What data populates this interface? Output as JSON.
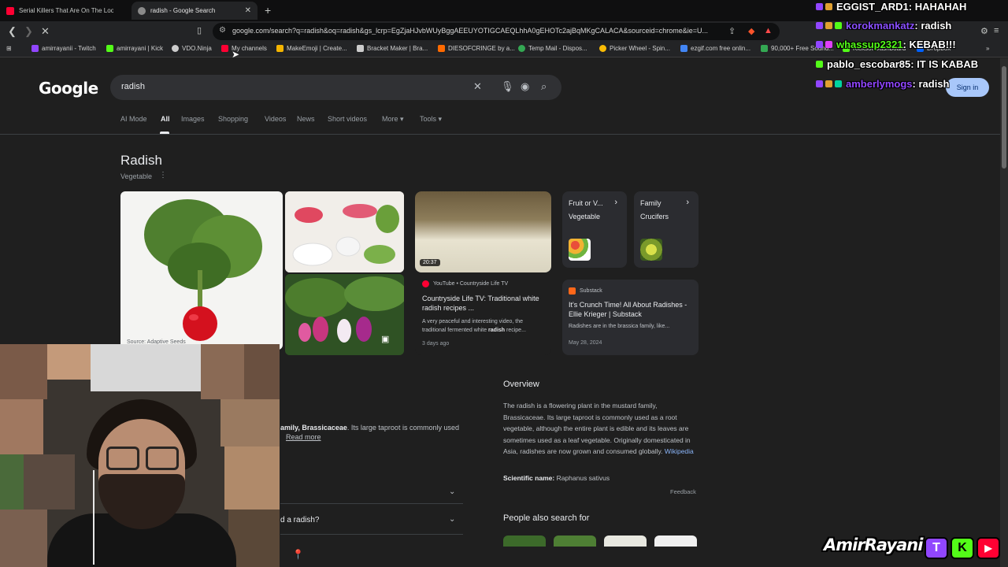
{
  "browser": {
    "tabs": [
      {
        "title": "Serial Killers That Are On The Loo",
        "fav_color": "#ff0033"
      },
      {
        "title": "radish - Google Search",
        "fav_color": "#8a8a8a"
      }
    ],
    "url": "google.com/search?q=radish&oq=radish&gs_lcrp=EgZjaHJvbWUyBggAEEUYOTIGCAEQLhhA0gEHOTc2ajBqMKgCALACA&sourceid=chrome&ie=U...",
    "bookmarks": [
      {
        "label": "amirrayanii - Twitch",
        "color": "#9146ff"
      },
      {
        "label": "amirrayani | Kick",
        "color": "#53fc18"
      },
      {
        "label": "VDO.Ninja",
        "color": "#cccccc"
      },
      {
        "label": "My channels",
        "color": "#ff0033"
      },
      {
        "label": "MakeEmoji | Create...",
        "color": "#f4b400"
      },
      {
        "label": "Bracket Maker | Bra...",
        "color": "#cccccc"
      },
      {
        "label": "DIESOFCRINGE by a...",
        "color": "#ff6a00"
      },
      {
        "label": "Temp Mail - Dispos...",
        "color": "#34a853"
      },
      {
        "label": "Picker Wheel - Spin...",
        "color": "#fbbc05"
      },
      {
        "label": "ezgif.com free onlin...",
        "color": "#4285f4"
      },
      {
        "label": "90,000+ Free Sound...",
        "color": "#34a853"
      },
      {
        "label": "Kicksot Dashboard",
        "color": "#53fc18"
      },
      {
        "label": "Dropbox",
        "color": "#0061fe"
      }
    ]
  },
  "google": {
    "logo": "Google",
    "query": "radish",
    "signin": "Sign in",
    "tabs": [
      "AI Mode",
      "All",
      "Images",
      "Shopping",
      "Videos",
      "News",
      "Short videos",
      "More",
      "Tools"
    ],
    "active_tab": "All"
  },
  "knowledge": {
    "title": "Radish",
    "subtitle": "Vegetable",
    "image_caption": "Source: Adaptive Seeds",
    "video": {
      "duration": "20:37",
      "source": "YouTube • Countryside Life TV",
      "title": "Countryside Life TV: Traditional white radish recipes ...",
      "snippet_pre": "A very peaceful and interesting video, the traditional fermented white ",
      "snippet_bold": "radish",
      "snippet_post": " recipe...",
      "date": "3 days ago"
    },
    "fruit_card": {
      "label": "Fruit or V...",
      "value": "Vegetable"
    },
    "family_card": {
      "label": "Family",
      "value": "Crucifers"
    },
    "substack": {
      "source": "Substack",
      "title": "It's Crunch Time! All About Radishes - Ellie Krieger | Substack",
      "snippet": "Radishes are in the brassica family, like...",
      "date": "May 28, 2024"
    },
    "left_desc_bold": "amily, Brassicaceae",
    "left_desc_rest": ". Its large taproot is commonly used",
    "read_more": "Read more",
    "left_question": "d a radish?",
    "overview": {
      "heading": "Overview",
      "text": "The radish is a flowering plant in the mustard family, Brassicaceae. Its large taproot is commonly used as a root vegetable, although the entire plant is edible and its leaves are sometimes used as a leaf vegetable. Originally domesticated in Asia, radishes are now grown and consumed globally.",
      "wiki": "Wikipedia",
      "sci_label": "Scientific name:",
      "sci_value": "Raphanus sativus",
      "feedback": "Feedback",
      "people_also": "People also search for"
    }
  },
  "chat": [
    {
      "user": "EGGIST_ARD1",
      "msg": ": HAHAHAH",
      "color": "#ffffff"
    },
    {
      "user": "korokmankatz",
      "msg": ": radish",
      "color": "#8a4fff"
    },
    {
      "user": "whassup2321",
      "msg": ": KEBAB!!!",
      "color": "#53fc18"
    },
    {
      "user": "pablo_escobar85",
      "msg": ": IT IS KABAB",
      "color": "#ffffff"
    },
    {
      "user": "amberlymogs",
      "msg": ": radish",
      "color": "#9146ff"
    }
  ],
  "brand": {
    "name": "AmirRayani",
    "logos": [
      "T",
      "K",
      "▶"
    ]
  }
}
